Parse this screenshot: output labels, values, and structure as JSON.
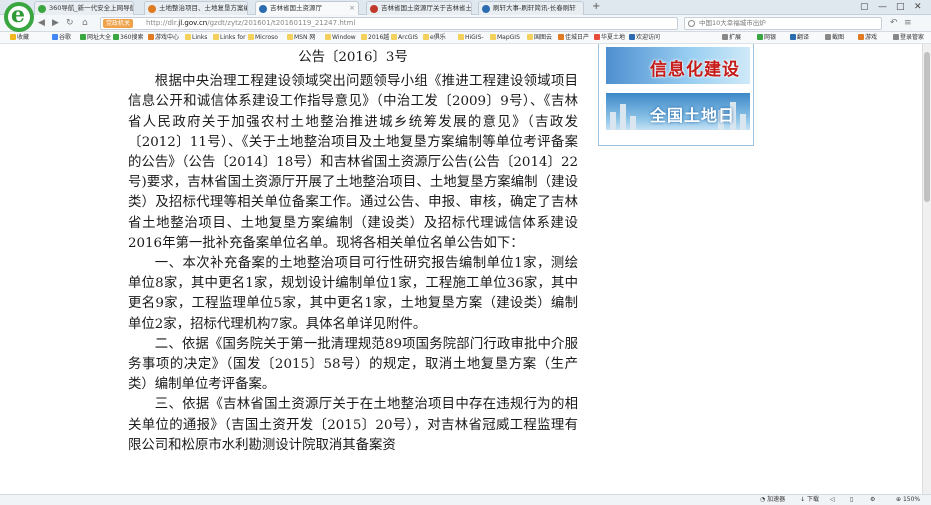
{
  "tabs": [
    {
      "label": "360导航_新一代安全上网导航",
      "active": false,
      "color": "#3aa63f"
    },
    {
      "label": "土地整治项目、土地复垦方案编",
      "active": false,
      "color": "#e07b22"
    },
    {
      "label": "吉林省国土资源厅",
      "active": true,
      "color": "#2b6cb0"
    },
    {
      "label": "吉林省国土资源厅关于吉林省土地",
      "active": false,
      "color": "#c0392b"
    },
    {
      "label": "刷轩大事-刷轩简讯-长春刷轩",
      "active": false,
      "color": "#2b6cb0"
    }
  ],
  "window_controls": [
    "▢",
    "—",
    "□",
    "✕"
  ],
  "address": {
    "badge": "党政机关",
    "url_prefix": "http://dlr.",
    "url_domain": "jl.gov.cn",
    "url_rest": "/gzdt/zytz/201601/t20160119_21247.html"
  },
  "search": {
    "placeholder": "中国10大幸福城市出炉"
  },
  "bookmarks": [
    "收藏",
    "谷歌",
    "网址大全",
    "360搜索",
    "游戏中心",
    "Links",
    "Links for",
    "Microso",
    "MSN 网",
    "Window",
    "2016越",
    "ArcGIS",
    "e俱乐",
    "HiGIS-",
    "MapGIS",
    "国图云",
    "佳城日产",
    "华夏土地",
    "欢迎访问"
  ],
  "toolbar_right": [
    "扩展",
    "网银",
    "翻译",
    "截图",
    "游戏",
    "登录管家"
  ],
  "article": {
    "doc_no": "公告〔2016〕3号",
    "paragraphs": [
      "根据中央治理工程建设领域突出问题领导小组《推进工程建设领域项目信息公开和诚信体系建设工作指导意见》（中治工发〔2009〕9号）、《吉林省人民政府关于加强农村土地整治推进城乡统筹发展的意见》（吉政发〔2012〕11号）、《关于土地整治项目及土地复垦方案编制等单位考评备案的公告》（公告〔2014〕18号）和吉林省国土资源厅公告(公告〔2014〕22号)要求，吉林省国土资源厅开展了土地整治项目、土地复垦方案编制（建设类）及招标代理等相关单位备案工作。通过公告、申报、审核，确定了吉林省土地整治项目、土地复垦方案编制（建设类）及招标代理诚信体系建设2016年第一批补充备案单位名单。现将各相关单位名单公告如下：",
      "一、本次补充备案的土地整治项目可行性研究报告编制单位1家，测绘单位8家，其中更名1家，规划设计编制单位1家，工程施工单位36家，其中更名9家，工程监理单位5家，其中更名1家，土地复垦方案（建设类）编制单位2家，招标代理机构7家。具体名单详见附件。",
      "二、依据《国务院关于第一批清理规范89项国务院部门行政审批中介服务事项的决定》（国发〔2015〕58号）的规定，取消土地复垦方案（生产类）编制单位考评备案。",
      "三、依据《吉林省国土资源厅关于在土地整治项目中存在违规行为的相关单位的通报》（吉国土资开发〔2015〕20号），对吉林省冠威工程监理有限公司和松原市水利勘测设计院取消其备案资"
    ]
  },
  "sidebar": {
    "banner1": "信息化建设",
    "banner2": "全国土地日"
  },
  "status": {
    "accelerator": "加速器",
    "download": "下载",
    "zoom": "150%"
  }
}
